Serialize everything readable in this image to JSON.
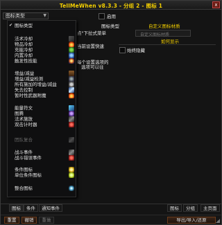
{
  "window": {
    "title": "TellMeWhen v8.3.3 - 分组 2 - 图标 1",
    "close": "x"
  },
  "type_dropdown": {
    "value": "图标类型",
    "arrow": "▼"
  },
  "menu": {
    "items": [
      {
        "label": "图标类型",
        "checked": true,
        "icon": "gear-icon",
        "disabled": false
      },
      {
        "label": "",
        "separator": true
      },
      {
        "label": "法术冷却",
        "icon": "texture-icon"
      },
      {
        "label": "物品冷却",
        "icon": "fire-icon"
      },
      {
        "label": "充能冷却",
        "icon": "green-icon"
      },
      {
        "label": "内置冷却",
        "icon": "blue-icon"
      },
      {
        "label": "触发性技能",
        "icon": "swirl-icon"
      },
      {
        "label": "",
        "separator": true
      },
      {
        "label": "增益/减益",
        "icon": "book-icon"
      },
      {
        "label": "增益/减益检测",
        "icon": "grey-icon"
      },
      {
        "label": "所有施加的增益/减益",
        "icon": "skull-icon"
      },
      {
        "label": "失去控制",
        "icon": "lightning-icon"
      },
      {
        "label": "暂时性武器附魔",
        "icon": "fire-icon"
      },
      {
        "label": "",
        "separator": true
      },
      {
        "label": "能量符文",
        "icon": "crystal-icon"
      },
      {
        "label": "图腾",
        "icon": "purple-icon"
      },
      {
        "label": "法术施放",
        "icon": "feather-icon"
      },
      {
        "label": "双击计时器",
        "icon": "red-icon"
      },
      {
        "label": "",
        "separator": true
      },
      {
        "label": "团队复合",
        "icon": "feather-icon",
        "disabled": true
      },
      {
        "label": "",
        "separator": true
      },
      {
        "label": "战斗事件",
        "icon": "feather-icon"
      },
      {
        "label": "战斗错误事件",
        "icon": "red-icon"
      },
      {
        "label": "",
        "separator": true
      },
      {
        "label": "条件图标",
        "icon": "yellow-icon"
      },
      {
        "label": "单位条件图标",
        "icon": "yellow2-icon"
      },
      {
        "label": "",
        "separator": true
      },
      {
        "label": "整合图标",
        "icon": "orb-icon"
      }
    ]
  },
  "cutoff_text": {
    "line1": "点\"下拉式菜单",
    "line2": "当前设置快速",
    "line3": "每个设置选项的",
    "line4": "选项可以往",
    "line5": "在此"
  },
  "right_panel": {
    "enabled_label": "启用",
    "icon_type_label": "图标类型",
    "custom_texture_label": "自定义图标材质",
    "custom_texture_placeholder": "自定义图标材质",
    "show_hide_label": "如何显示",
    "always_hide_label": "始终隐藏"
  },
  "tabs": {
    "items": [
      "图标",
      "条件",
      "通知事件",
      "图标",
      "分组",
      "主页面"
    ]
  },
  "footer": {
    "reset": "重置",
    "undo": "撤销",
    "redo": "重做",
    "import_export": "导出/导入/还原"
  }
}
